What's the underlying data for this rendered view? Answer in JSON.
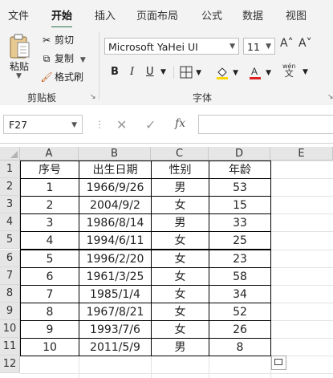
{
  "ribbon_tabs": [
    "文件",
    "开始",
    "插入",
    "页面布局",
    "公式",
    "数据",
    "视图"
  ],
  "active_tab": "开始",
  "clipboard": {
    "paste_label": "粘贴",
    "cut_label": "剪切",
    "copy_label": "复制",
    "format_painter_label": "格式刷",
    "group_label": "剪贴板"
  },
  "font": {
    "name": "Microsoft YaHei UI",
    "size": "11",
    "grow_glyph": "A˄",
    "shrink_glyph": "A˅",
    "bold": "B",
    "italic": "I",
    "underline": "U",
    "phonetic_top": "wén",
    "phonetic_bottom": "文",
    "group_label": "字体",
    "fill_color": "#ffd700",
    "font_color": "#e02020"
  },
  "formula_bar": {
    "name_box": "F27",
    "fx": "fx",
    "formula": ""
  },
  "grid": {
    "columns": [
      "A",
      "B",
      "C",
      "D",
      "E"
    ],
    "row_numbers": [
      "1",
      "2",
      "3",
      "4",
      "5",
      "6",
      "7",
      "8",
      "9",
      "10",
      "11",
      "12"
    ],
    "header": [
      "序号",
      "出生日期",
      "性别",
      "年龄"
    ],
    "rows": [
      [
        "1",
        "1966/9/26",
        "男",
        "53"
      ],
      [
        "2",
        "2004/9/2",
        "女",
        "15"
      ],
      [
        "3",
        "1986/8/14",
        "男",
        "33"
      ],
      [
        "4",
        "1994/6/11",
        "女",
        "25"
      ],
      [
        "5",
        "1996/2/20",
        "女",
        "23"
      ],
      [
        "6",
        "1961/3/25",
        "女",
        "58"
      ],
      [
        "7",
        "1985/1/4",
        "女",
        "34"
      ],
      [
        "8",
        "1967/8/21",
        "女",
        "52"
      ],
      [
        "9",
        "1993/7/6",
        "女",
        "26"
      ],
      [
        "10",
        "2011/5/9",
        "男",
        "8"
      ]
    ]
  },
  "colors": {
    "accent": "#217346",
    "ribbon_bg": "#f3f3f3",
    "header_bg": "#e6e6e6"
  }
}
